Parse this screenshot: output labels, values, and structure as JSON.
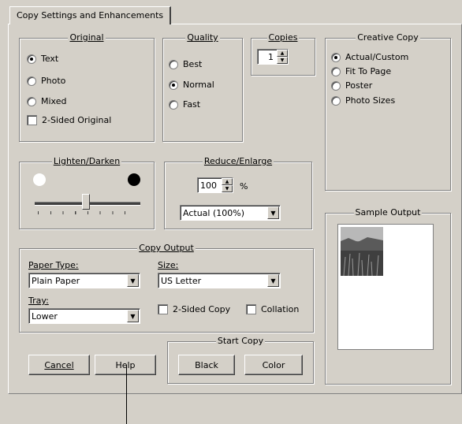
{
  "tab": {
    "label": "Copy Settings and Enhancements"
  },
  "original": {
    "legend": "Original",
    "options": [
      "Text",
      "Photo",
      "Mixed"
    ],
    "selected": "Text",
    "two_sided_label": "2-Sided Original"
  },
  "quality": {
    "legend": "Quality",
    "options": [
      "Best",
      "Normal",
      "Fast"
    ],
    "selected": "Normal"
  },
  "copies": {
    "legend": "Copies",
    "value": "1"
  },
  "creative_copy": {
    "legend": "Creative Copy",
    "options": [
      "Actual/Custom",
      "Fit To Page",
      "Poster",
      "Photo Sizes"
    ],
    "selected": "Actual/Custom"
  },
  "lighten_darken": {
    "legend": "Lighten/Darken",
    "level": 0.5
  },
  "reduce_enlarge": {
    "legend": "Reduce/Enlarge",
    "value": "100",
    "unit": "%",
    "preset": "Actual (100%)"
  },
  "sample_output": {
    "legend": "Sample Output"
  },
  "copy_output": {
    "legend": "Copy Output",
    "paper_type_label": "Paper Type:",
    "paper_type_value": "Plain Paper",
    "size_label": "Size:",
    "size_value": "US Letter",
    "tray_label": "Tray:",
    "tray_value": "Lower",
    "two_sided_copy_label": "2-Sided Copy",
    "collation_label": "Collation"
  },
  "start_copy": {
    "legend": "Start Copy",
    "black_label": "Black",
    "color_label": "Color"
  },
  "buttons": {
    "cancel": "Cancel",
    "help": "Help"
  }
}
